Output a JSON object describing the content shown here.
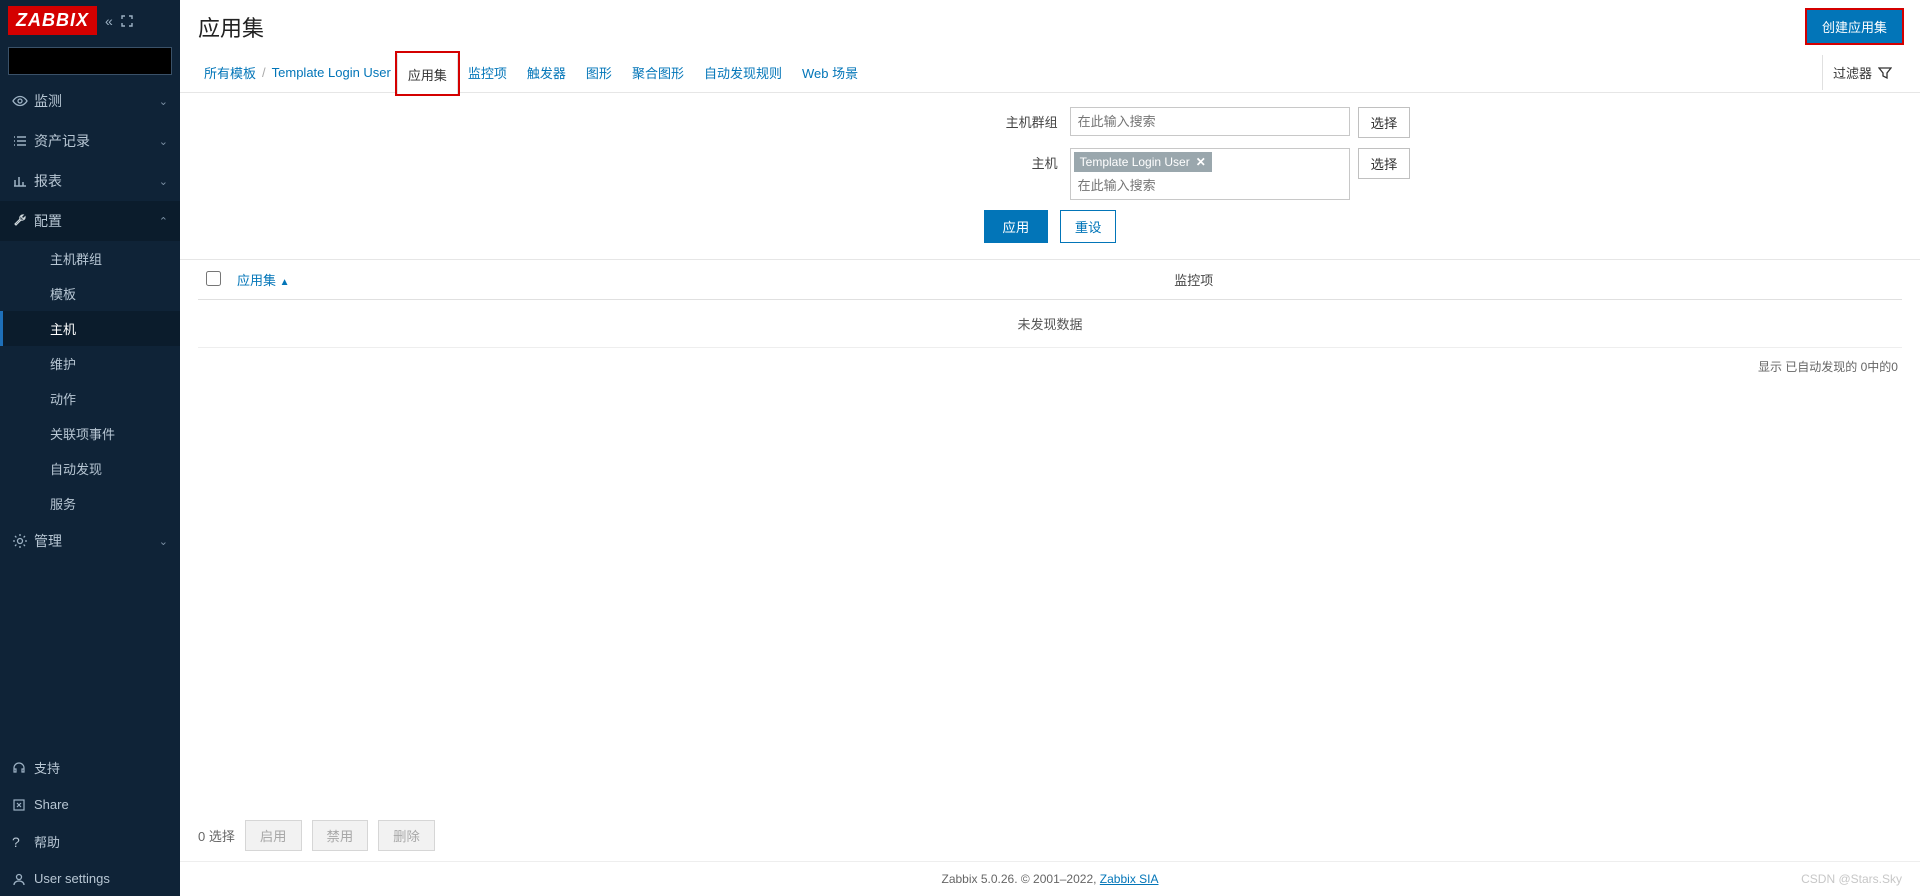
{
  "brand": "ZABBIX",
  "page_title": "应用集",
  "create_button": "创建应用集",
  "breadcrumb": {
    "all_templates": "所有模板",
    "template_name": "Template Login User"
  },
  "tabs": {
    "app": "应用集",
    "items": "监控项",
    "triggers": "触发器",
    "graphs": "图形",
    "screens": "聚合图形",
    "discovery": "自动发现规则",
    "web": "Web 场景"
  },
  "filter_label": "过滤器",
  "filter": {
    "host_group_label": "主机群组",
    "host_label": "主机",
    "placeholder": "在此输入搜索",
    "select": "选择",
    "tag_text": "Template Login User",
    "apply": "应用",
    "reset": "重设"
  },
  "table": {
    "col_app": "应用集",
    "col_items": "监控项",
    "empty": "未发现数据",
    "info": "显示 已自动发现的 0中的0"
  },
  "bulk": {
    "selected": "0 选择",
    "enable": "启用",
    "disable": "禁用",
    "delete": "删除"
  },
  "sidebar": {
    "monitoring": "监测",
    "inventory": "资产记录",
    "reports": "报表",
    "config": "配置",
    "config_items": {
      "hostgroups": "主机群组",
      "templates": "模板",
      "hosts": "主机",
      "maintenance": "维护",
      "actions": "动作",
      "correlation": "关联项事件",
      "discovery": "自动发现",
      "services": "服务"
    },
    "admin": "管理",
    "support": "支持",
    "share": "Share",
    "help": "帮助",
    "user": "User settings"
  },
  "footer": {
    "text_a": "Zabbix 5.0.26. © 2001–2022, ",
    "link": "Zabbix SIA",
    "watermark": "CSDN @Stars.Sky"
  }
}
